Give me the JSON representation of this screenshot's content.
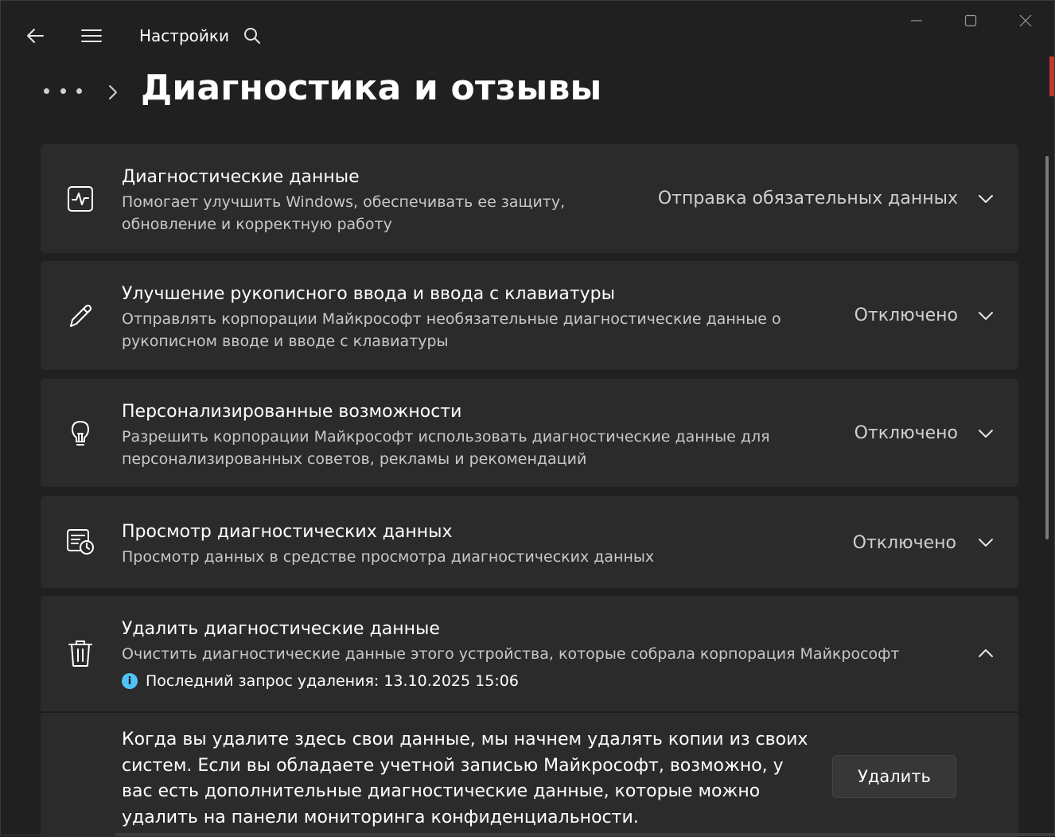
{
  "app": {
    "title": "Настройки"
  },
  "page": {
    "title": "Диагностика и отзывы"
  },
  "cards": [
    {
      "title": "Диагностические данные",
      "desc": "Помогает улучшить Windows, обеспечивать ее защиту, обновление и корректную работу",
      "value": "Отправка обязательных данных",
      "icon": "pulse-icon"
    },
    {
      "title": "Улучшение рукописного ввода и ввода с клавиатуры",
      "desc": "Отправлять корпорации Майкрософт необязательные диагностические данные о рукописном вводе и вводе с клавиатуры",
      "value": "Отключено",
      "icon": "pen-icon"
    },
    {
      "title": "Персонализированные возможности",
      "desc": "Разрешить корпорации Майкрософт использовать диагностические данные для персонализированных советов, рекламы и рекомендаций",
      "value": "Отключено",
      "icon": "lightbulb-icon"
    },
    {
      "title": "Просмотр диагностических данных",
      "desc": "Просмотр данных в средстве просмотра диагностических данных",
      "value": "Отключено",
      "icon": "data-viewer-icon"
    },
    {
      "title": "Удалить диагностические данные",
      "desc": "Очистить диагностические данные этого устройства, которые собрала корпорация Майкрософт",
      "info": "Последний запрос удаления: 13.10.2025 15:06",
      "icon": "trash-icon"
    }
  ],
  "delete_section": {
    "text": "Когда вы удалите здесь свои данные, мы начнем удалять копии из своих систем. Если вы обладаете учетной записью Майкрософт, возможно, у вас есть дополнительные диагностические данные, которые можно удалить на панели мониторинга конфиденциальности.",
    "button": "Удалить"
  },
  "colors": {
    "background": "#202020",
    "card": "#2b2b2b",
    "info_accent": "#4fc3f7"
  }
}
